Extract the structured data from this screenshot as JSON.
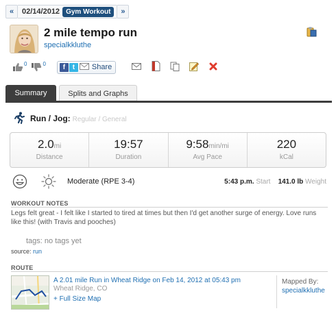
{
  "date_nav": {
    "prev": "«",
    "date": "02/14/2012",
    "tag": "Gym Workout",
    "next": "»"
  },
  "workout": {
    "title": "2 mile tempo run",
    "username": "specialkkluthe"
  },
  "actions": {
    "likes": "0",
    "dislikes": "0",
    "share_label": "Share",
    "fb_glyph": "f",
    "tw_glyph": "t"
  },
  "tabs": {
    "summary": "Summary",
    "splits": "Splits and Graphs"
  },
  "activity": {
    "type": "Run / Jog:",
    "subtype": "Regular / General"
  },
  "stats": [
    {
      "value": "2.0",
      "unit": "mi",
      "label": "Distance"
    },
    {
      "value": "19:57",
      "unit": "",
      "label": "Duration"
    },
    {
      "value": "9:58",
      "unit": "min/mi",
      "label": "Avg Pace"
    },
    {
      "value": "220",
      "unit": "",
      "label": "kCal"
    }
  ],
  "feel": {
    "intensity": "Moderate (RPE 3-4)",
    "start_time": "5:43 p.m.",
    "start_label": "Start",
    "weight": "141.0 lb",
    "weight_label": "Weight"
  },
  "notes": {
    "heading": "WORKOUT NOTES",
    "text": "Legs felt great - I felt like I started to tired at times but then I'd get another surge of energy. Love runs like this! (with Travis and pooches)",
    "tags": "tags: no tags yet",
    "source_label": "source:",
    "source_value": "run"
  },
  "route": {
    "heading": "ROUTE",
    "link": "A 2.01 mile Run in Wheat Ridge on Feb 14, 2012 at 05:43 pm",
    "location": "Wheat Ridge, CO",
    "full_map": "+ Full Size Map",
    "mapped_by_label": "Mapped By:",
    "mapped_by_user": "specialkkluthe"
  },
  "colors": {
    "accent_blue": "#1f6fb2",
    "tag_navy": "#1e4f7d",
    "tab_dark": "#3d3d3d",
    "delete_red": "#e03b2c"
  },
  "icons": [
    "thumbs-up-icon",
    "thumbs-down-icon",
    "facebook-icon",
    "twitter-icon",
    "mail-icon",
    "print-icon",
    "copy-icon",
    "edit-icon",
    "delete-icon",
    "clipboard-icon",
    "runner-icon",
    "smiley-icon",
    "sun-icon"
  ]
}
